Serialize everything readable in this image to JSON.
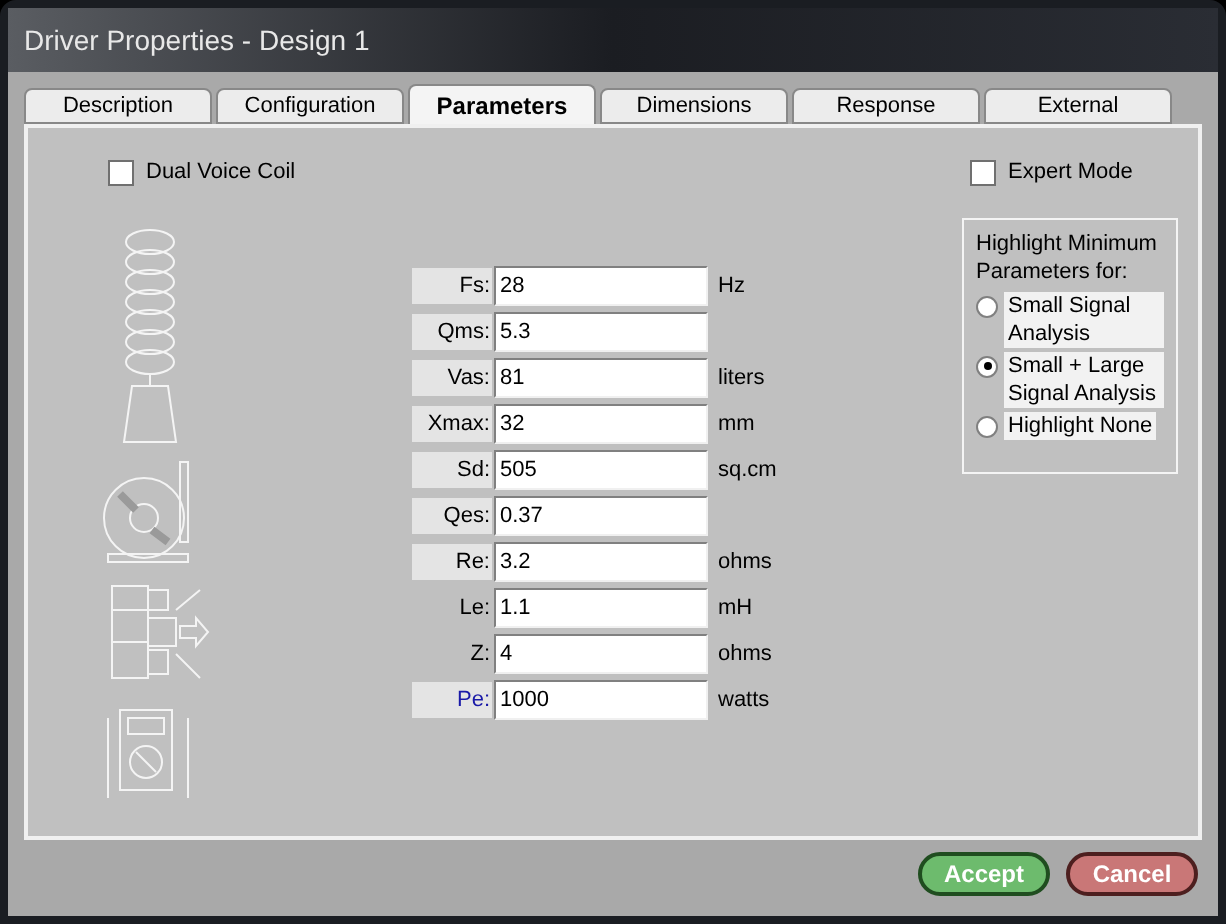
{
  "window": {
    "title": "Driver Properties - Design 1"
  },
  "tabs": [
    {
      "label": "Description",
      "selected": false
    },
    {
      "label": "Configuration",
      "selected": false
    },
    {
      "label": "Parameters",
      "selected": true
    },
    {
      "label": "Dimensions",
      "selected": false
    },
    {
      "label": "Response",
      "selected": false
    },
    {
      "label": "External",
      "selected": false
    }
  ],
  "dual_voice_coil": {
    "label": "Dual Voice Coil",
    "checked": false
  },
  "expert_mode": {
    "label": "Expert Mode",
    "checked": false
  },
  "parameters": [
    {
      "label": "Fs:",
      "value": "28",
      "unit": "Hz",
      "highlighted": true,
      "color": "#000000"
    },
    {
      "label": "Qms:",
      "value": "5.3",
      "highlighted": true,
      "color": "#000000"
    },
    {
      "label": "Vas:",
      "value": "81",
      "unit": "liters",
      "highlighted": true,
      "color": "#000000"
    },
    {
      "label": "Xmax:",
      "value": "32",
      "unit": "mm",
      "highlighted": true,
      "color": "#000000"
    },
    {
      "label": "Sd:",
      "value": "505",
      "unit": "sq.cm",
      "highlighted": true,
      "color": "#000000"
    },
    {
      "label": "Qes:",
      "value": "0.37",
      "highlighted": true,
      "color": "#000000"
    },
    {
      "label": "Re:",
      "value": "3.2",
      "unit": "ohms",
      "highlighted": true,
      "color": "#000000"
    },
    {
      "label": "Le:",
      "value": "1.1",
      "unit": "mH",
      "highlighted": false,
      "color": "#000000"
    },
    {
      "label": "Z:",
      "value": "4",
      "unit": "ohms",
      "highlighted": false,
      "color": "#000000"
    },
    {
      "label": "Pe:",
      "value": "1000",
      "unit": "watts",
      "highlighted": true,
      "color": "#1a1aa8"
    }
  ],
  "highlight_group": {
    "title": "Highlight Minimum Parameters for:",
    "options": [
      {
        "label": "Small Signal Analysis",
        "selected": false
      },
      {
        "label": "Small + Large Signal Analysis",
        "selected": true
      },
      {
        "label": "Highlight None",
        "selected": false
      }
    ]
  },
  "buttons": [
    {
      "label": "Accept",
      "kind": "accept"
    },
    {
      "label": "Cancel",
      "kind": "cancel"
    }
  ]
}
